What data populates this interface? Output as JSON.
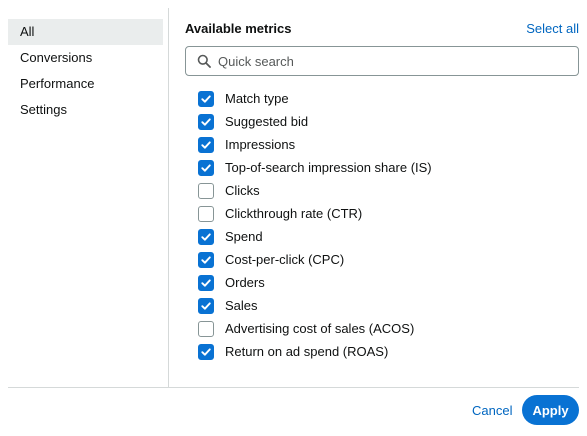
{
  "sidebar": {
    "items": [
      {
        "label": "All",
        "active": true
      },
      {
        "label": "Conversions",
        "active": false
      },
      {
        "label": "Performance",
        "active": false
      },
      {
        "label": "Settings",
        "active": false
      }
    ]
  },
  "main": {
    "title": "Available metrics",
    "select_all_label": "Select all",
    "search": {
      "placeholder": "Quick search",
      "value": "",
      "icon": "search-icon"
    },
    "metrics": [
      {
        "label": "Match type",
        "checked": true
      },
      {
        "label": "Suggested bid",
        "checked": true
      },
      {
        "label": "Impressions",
        "checked": true
      },
      {
        "label": "Top-of-search impression share (IS)",
        "checked": true
      },
      {
        "label": "Clicks",
        "checked": false
      },
      {
        "label": "Clickthrough rate (CTR)",
        "checked": false
      },
      {
        "label": "Spend",
        "checked": true
      },
      {
        "label": "Cost-per-click (CPC)",
        "checked": true
      },
      {
        "label": "Orders",
        "checked": true
      },
      {
        "label": "Sales",
        "checked": true
      },
      {
        "label": "Advertising cost of sales (ACOS)",
        "checked": false
      },
      {
        "label": "Return on ad spend (ROAS)",
        "checked": true
      }
    ]
  },
  "footer": {
    "cancel_label": "Cancel",
    "apply_label": "Apply"
  },
  "colors": {
    "accent": "#0972d3",
    "link": "#0066c0",
    "active_bg": "#eaeded",
    "divider": "#d5d9d9"
  }
}
